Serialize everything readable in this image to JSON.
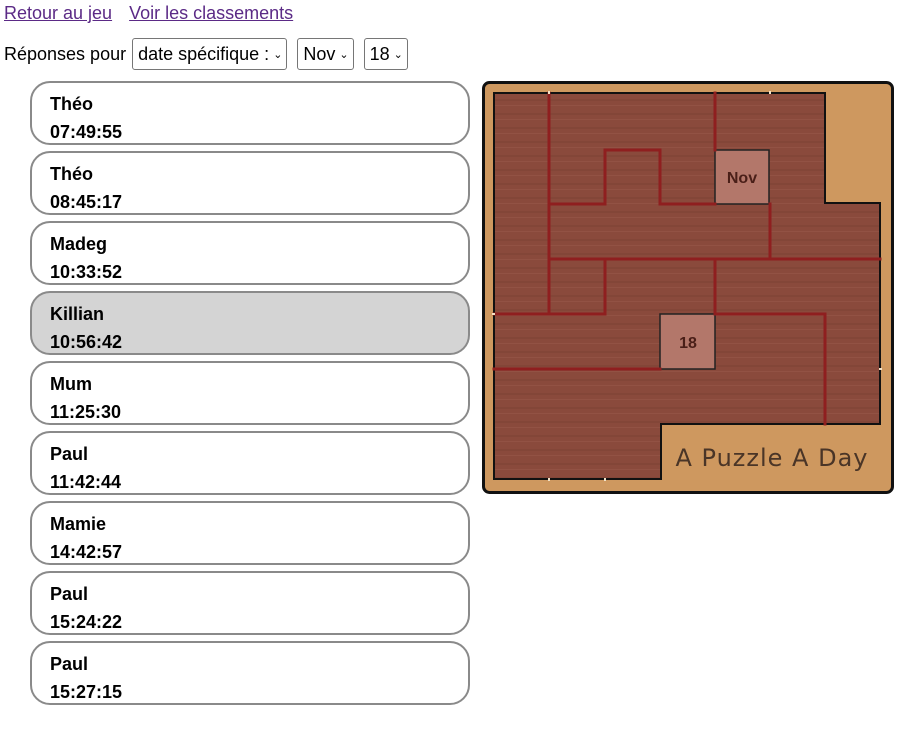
{
  "nav": {
    "back": "Retour au jeu",
    "rankings": "Voir les classements"
  },
  "filters": {
    "label": "Réponses pour",
    "mode": "date spécifique :",
    "month": "Nov",
    "day": "18"
  },
  "entries": [
    {
      "name": "Théo",
      "time": "07:49:55"
    },
    {
      "name": "Théo",
      "time": "08:45:17"
    },
    {
      "name": "Madeg",
      "time": "10:33:52"
    },
    {
      "name": "Killian",
      "time": "10:56:42",
      "selected": true
    },
    {
      "name": "Mum",
      "time": "11:25:30"
    },
    {
      "name": "Paul",
      "time": "11:42:44"
    },
    {
      "name": "Mamie",
      "time": "14:42:57"
    },
    {
      "name": "Paul",
      "time": "15:24:22"
    },
    {
      "name": "Paul",
      "time": "15:27:15"
    }
  ],
  "board": {
    "title": "A Puzzle A Day",
    "month_cell": "Nov",
    "day_cell": "18",
    "colors": {
      "frame": "#c9935a",
      "piece": "#8a4a3c",
      "edge": "#8f1f1f",
      "open_cell": "#b3776a"
    }
  }
}
